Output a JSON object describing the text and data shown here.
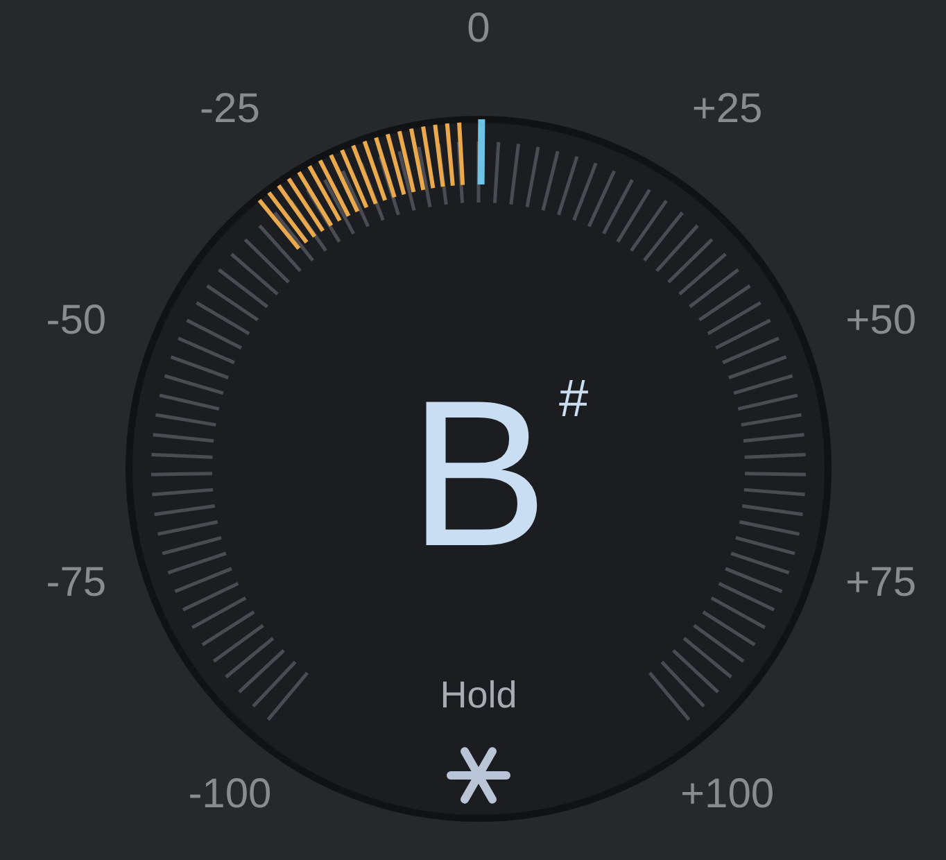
{
  "scale_labels": [
    "-100",
    "-75",
    "-50",
    "-25",
    "0",
    "+25",
    "+50",
    "+75",
    "+100"
  ],
  "meter": {
    "level": 0.36
  },
  "note": {
    "name": "B",
    "accidental": "#"
  },
  "hold": {
    "label": "Hold"
  }
}
